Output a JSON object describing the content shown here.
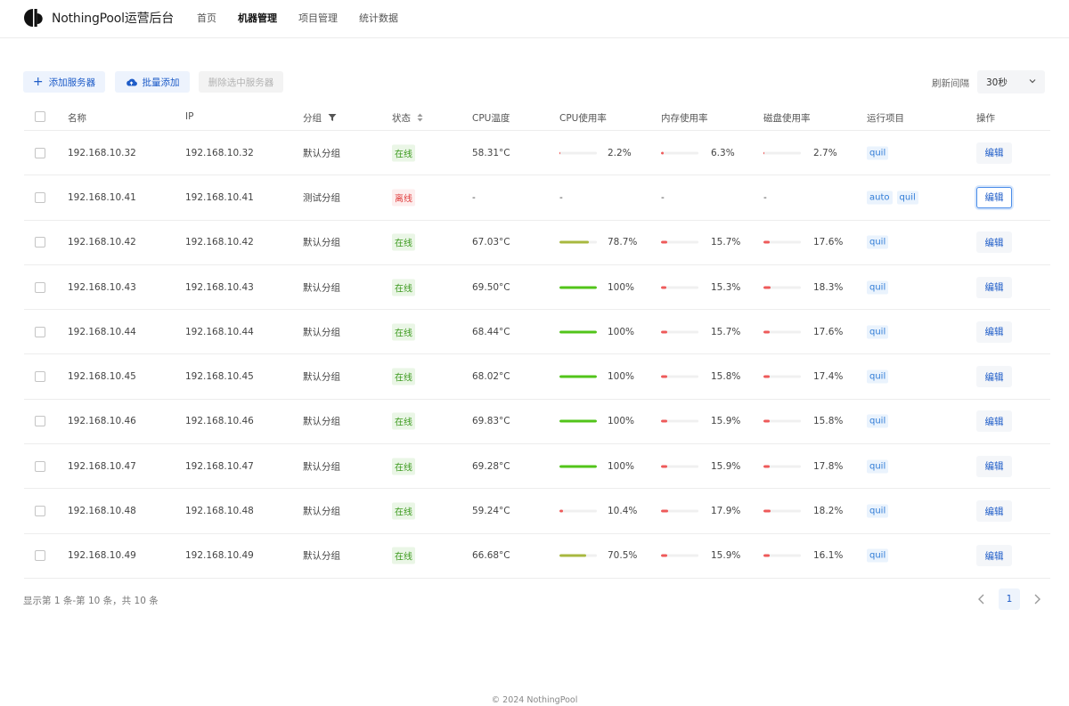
{
  "header": {
    "brand": "NothingPool运营后台",
    "nav": [
      {
        "label": "首页",
        "active": false
      },
      {
        "label": "机器管理",
        "active": true
      },
      {
        "label": "项目管理",
        "active": false
      },
      {
        "label": "统计数据",
        "active": false
      }
    ]
  },
  "toolbar": {
    "add_label": "添加服务器",
    "batch_label": "批量添加",
    "delete_label": "删除选中服务器",
    "refresh_label": "刷新间隔",
    "refresh_value": "30秒"
  },
  "table": {
    "columns": {
      "name": "名称",
      "ip": "IP",
      "group": "分组",
      "status": "状态",
      "cpu_temp": "CPU温度",
      "cpu_usage": "CPU使用率",
      "mem_usage": "内存使用率",
      "disk_usage": "磁盘使用率",
      "projects": "运行项目",
      "actions": "操作"
    },
    "edit_label": "编辑",
    "rows": [
      {
        "name": "192.168.10.32",
        "ip": "192.168.10.32",
        "group": "默认分组",
        "status": "在线",
        "online": true,
        "cpu_temp": "58.31°C",
        "cpu": "2.2%",
        "cpu_v": 2.2,
        "mem": "6.3%",
        "mem_v": 6.3,
        "disk": "2.7%",
        "disk_v": 2.7,
        "projects": [
          "quil"
        ]
      },
      {
        "name": "192.168.10.41",
        "ip": "192.168.10.41",
        "group": "测试分组",
        "status": "离线",
        "online": false,
        "cpu_temp": "-",
        "cpu": "-",
        "mem": "-",
        "disk": "-",
        "projects": [
          "auto",
          "quil"
        ],
        "focused": true
      },
      {
        "name": "192.168.10.42",
        "ip": "192.168.10.42",
        "group": "默认分组",
        "status": "在线",
        "online": true,
        "cpu_temp": "67.03°C",
        "cpu": "78.7%",
        "cpu_v": 78.7,
        "mem": "15.7%",
        "mem_v": 15.7,
        "disk": "17.6%",
        "disk_v": 17.6,
        "projects": [
          "quil"
        ]
      },
      {
        "name": "192.168.10.43",
        "ip": "192.168.10.43",
        "group": "默认分组",
        "status": "在线",
        "online": true,
        "cpu_temp": "69.50°C",
        "cpu": "100%",
        "cpu_v": 100,
        "mem": "15.3%",
        "mem_v": 15.3,
        "disk": "18.3%",
        "disk_v": 18.3,
        "projects": [
          "quil"
        ]
      },
      {
        "name": "192.168.10.44",
        "ip": "192.168.10.44",
        "group": "默认分组",
        "status": "在线",
        "online": true,
        "cpu_temp": "68.44°C",
        "cpu": "100%",
        "cpu_v": 100,
        "mem": "15.7%",
        "mem_v": 15.7,
        "disk": "17.6%",
        "disk_v": 17.6,
        "projects": [
          "quil"
        ]
      },
      {
        "name": "192.168.10.45",
        "ip": "192.168.10.45",
        "group": "默认分组",
        "status": "在线",
        "online": true,
        "cpu_temp": "68.02°C",
        "cpu": "100%",
        "cpu_v": 100,
        "mem": "15.8%",
        "mem_v": 15.8,
        "disk": "17.4%",
        "disk_v": 17.4,
        "projects": [
          "quil"
        ]
      },
      {
        "name": "192.168.10.46",
        "ip": "192.168.10.46",
        "group": "默认分组",
        "status": "在线",
        "online": true,
        "cpu_temp": "69.83°C",
        "cpu": "100%",
        "cpu_v": 100,
        "mem": "15.9%",
        "mem_v": 15.9,
        "disk": "15.8%",
        "disk_v": 15.8,
        "projects": [
          "quil"
        ]
      },
      {
        "name": "192.168.10.47",
        "ip": "192.168.10.47",
        "group": "默认分组",
        "status": "在线",
        "online": true,
        "cpu_temp": "69.28°C",
        "cpu": "100%",
        "cpu_v": 100,
        "mem": "15.9%",
        "mem_v": 15.9,
        "disk": "17.8%",
        "disk_v": 17.8,
        "projects": [
          "quil"
        ]
      },
      {
        "name": "192.168.10.48",
        "ip": "192.168.10.48",
        "group": "默认分组",
        "status": "在线",
        "online": true,
        "cpu_temp": "59.24°C",
        "cpu": "10.4%",
        "cpu_v": 10.4,
        "mem": "17.9%",
        "mem_v": 17.9,
        "disk": "18.2%",
        "disk_v": 18.2,
        "projects": [
          "quil"
        ]
      },
      {
        "name": "192.168.10.49",
        "ip": "192.168.10.49",
        "group": "默认分组",
        "status": "在线",
        "online": true,
        "cpu_temp": "66.68°C",
        "cpu": "70.5%",
        "cpu_v": 70.5,
        "mem": "15.9%",
        "mem_v": 15.9,
        "disk": "16.1%",
        "disk_v": 16.1,
        "projects": [
          "quil"
        ]
      }
    ]
  },
  "pagination": {
    "summary": "显示第 1 条-第 10 条，共 10 条",
    "current": "1"
  },
  "colors": {
    "bar_full": "#52c41a",
    "bar_high": "#a8b83f",
    "bar_low": "#ee5a5a",
    "accent": "#1e5cc8"
  },
  "footer": {
    "copyright": "© 2024 NothingPool"
  }
}
